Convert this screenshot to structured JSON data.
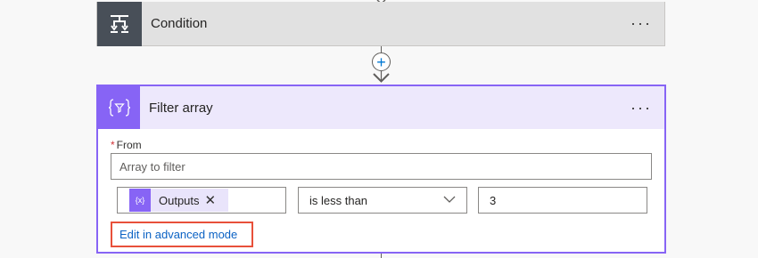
{
  "condition": {
    "title": "Condition",
    "more_label": "···",
    "icon": "condition-branch-icon"
  },
  "add_step": {
    "label": "+"
  },
  "filter_array": {
    "title": "Filter array",
    "more_label": "···",
    "icon": "filter-array-icon",
    "accent_color": "#8764f5",
    "from_required_mark": "*",
    "from_label": "From",
    "from_placeholder": "Array to filter",
    "token": {
      "icon_text": "{x}",
      "label": "Outputs",
      "remove_label": "✕"
    },
    "operator": "is less than",
    "value": "3",
    "advanced_link": "Edit in advanced mode"
  }
}
